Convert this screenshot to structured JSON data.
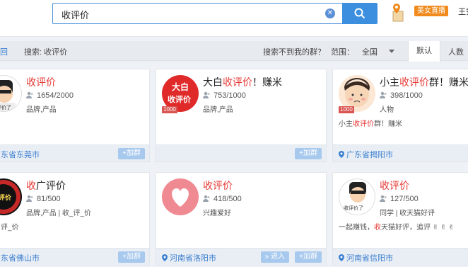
{
  "search": {
    "query": "收评价"
  },
  "header": {
    "live_badge": "美女直播",
    "user_cut": "王秀"
  },
  "filter": {
    "back_cut": "回",
    "search_label": "搜索: 收评价",
    "not_found": "搜索不到我的群？",
    "range_label": "范围：",
    "range_value": "全国",
    "tab_default": "默认",
    "tab_people": "人数"
  },
  "cards": [
    {
      "title_hl": "收评价",
      "title_rest": "",
      "members": "1654/2000",
      "tags": "品牌,产品",
      "desc": "",
      "desc_hl": "",
      "desc_rest": "",
      "location": "东省东莞市",
      "join": "+加群",
      "enter": "",
      "avatar_text": "收评价了",
      "level": ""
    },
    {
      "title_pre": "大白",
      "title_hl": "收评价",
      "title_rest": "！赚米",
      "members": "753/1000",
      "tags": "品牌,产品",
      "desc": "",
      "location": "",
      "join": "+加群",
      "enter": "",
      "avatar_text_1": "大白",
      "avatar_text_2": "收评价",
      "level": "1000"
    },
    {
      "title_pre": "小主",
      "title_hl": "收评价",
      "title_rest": "群！赚米",
      "members": "398/1000",
      "tags": "人物",
      "desc_pre": "小主",
      "desc_hl": "收评价",
      "desc_rest": "群！赚米",
      "location": "广东省揭阳市",
      "join": "+加群",
      "enter": "",
      "level": "1000"
    },
    {
      "title_hl": "收",
      "title_rest": "广评价",
      "members": "81/500",
      "tags": "品牌,产品 | 收_评_价",
      "desc": "评_价",
      "location": "东省佛山市",
      "join": "+加群",
      "enter": "",
      "avatar_text": "收评价"
    },
    {
      "title_hl": "收评价",
      "title_rest": "",
      "members": "418/500",
      "tags": "兴趣爱好",
      "desc": "",
      "location": "河南省洛阳市",
      "join": "+加群",
      "enter": "» 进入"
    },
    {
      "title_hl": "收评价",
      "title_rest": "",
      "members": "127/500",
      "tags": "同学 | 收天猫好评",
      "desc_pre": "一起赚钱，",
      "desc_hl": "收",
      "desc_rest": "天猫好评，追评 ✌ ✌ ✌",
      "location": "河南省信阳市",
      "join": "+加群",
      "enter": "",
      "avatar_text": "收评价了"
    }
  ],
  "colors": {
    "accent": "#3b8fde",
    "highlight": "#e53935",
    "link": "#3b7fd0",
    "badge": "#f08a1c"
  }
}
